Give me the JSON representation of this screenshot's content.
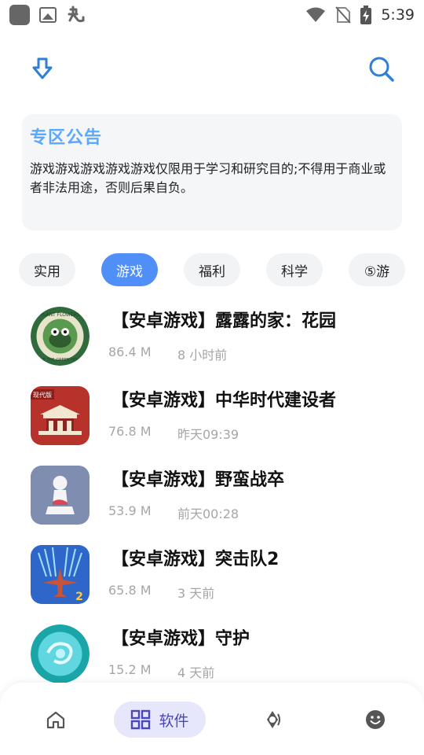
{
  "status_bar": {
    "time": "5:39"
  },
  "notice": {
    "title": "专区公告",
    "text": "游戏游戏游戏游戏游戏仅限用于学习和研究目的;不得用于商业或者非法用途，否则后果自负。"
  },
  "categories": [
    {
      "label": "实用",
      "active": false
    },
    {
      "label": "游戏",
      "active": true
    },
    {
      "label": "福利",
      "active": false
    },
    {
      "label": "科学",
      "active": false
    },
    {
      "label": "⑤游",
      "active": false
    }
  ],
  "apps": [
    {
      "title": "【安卓游戏】露露的家：花园",
      "size": "86.4 M",
      "time": "8 小时前",
      "icon": "plant-flowers-icon",
      "icon_text_top": "PLANT FLOWERS",
      "icon_text_bottom": "LOVE THE GREEN HOUSE"
    },
    {
      "title": "【安卓游戏】中华时代建设者",
      "size": "76.8 M",
      "time": "昨天09:39",
      "icon": "palace-icon",
      "icon_badge": "现代版"
    },
    {
      "title": "【安卓游戏】野蛮战卒",
      "size": "53.9 M",
      "time": "前天00:28",
      "icon": "pawn-icon"
    },
    {
      "title": "【安卓游戏】突击队2",
      "size": "65.8 M",
      "time": "3 天前",
      "icon": "fighter-plane-icon",
      "icon_badge": "2"
    },
    {
      "title": "【安卓游戏】守护",
      "size": "15.2 M",
      "time": "4 天前",
      "icon": "magic-orb-icon"
    }
  ],
  "bottom_nav": {
    "items": [
      {
        "name": "home",
        "icon": "home-icon"
      },
      {
        "name": "software",
        "icon": "grid-icon",
        "label": "软件",
        "active": true
      },
      {
        "name": "discover",
        "icon": "compass-icon"
      },
      {
        "name": "profile",
        "icon": "smiley-icon"
      }
    ]
  },
  "colors": {
    "accent": "#4f8ff7",
    "notice_title": "#5aa9ff",
    "nav_active_bg": "#e6e7fb",
    "nav_active_text": "#4a47b8"
  }
}
